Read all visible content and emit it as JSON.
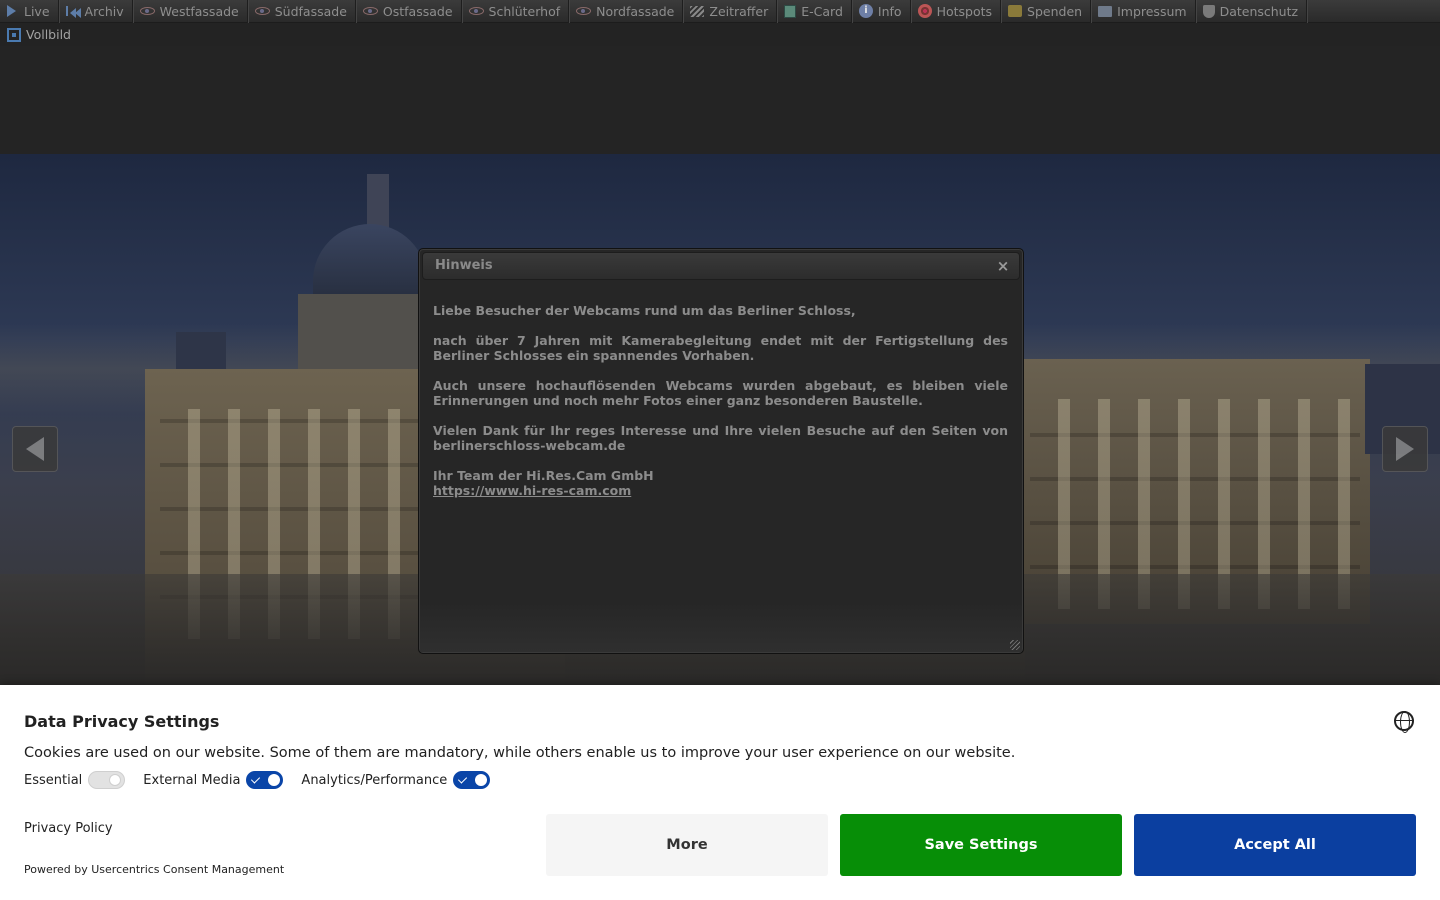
{
  "nav": {
    "row1": [
      {
        "label": "Live",
        "icon": "play-icon"
      },
      {
        "label": "Archiv",
        "icon": "rewind-icon"
      },
      {
        "label": "Westfassade",
        "icon": "eye-icon"
      },
      {
        "label": "Südfassade",
        "icon": "eye-icon"
      },
      {
        "label": "Ostfassade",
        "icon": "eye-icon"
      },
      {
        "label": "Schlüterhof",
        "icon": "eye-icon"
      },
      {
        "label": "Nordfassade",
        "icon": "eye-icon"
      },
      {
        "label": "Zeitraffer",
        "icon": "clapperboard-icon"
      },
      {
        "label": "E-Card",
        "icon": "ecard-icon"
      },
      {
        "label": "Info",
        "icon": "info-icon"
      },
      {
        "label": "Hotspots",
        "icon": "target-icon"
      },
      {
        "label": "Spenden",
        "icon": "coins-icon"
      },
      {
        "label": "Impressum",
        "icon": "imprint-icon"
      },
      {
        "label": "Datenschutz",
        "icon": "shield-icon"
      }
    ],
    "row2": [
      {
        "label": "Vollbild",
        "icon": "fullscreen-icon"
      }
    ]
  },
  "dialog": {
    "title": "Hinweis",
    "close_symbol": "×",
    "paragraphs": [
      "Liebe Besucher der Webcams rund um das Berliner Schloss,",
      "nach über 7 Jahren mit Kamerabegleitung endet mit der Fertigstellung des Berliner Schlosses ein spannendes Vorhaben.",
      "Auch unsere hochauflösenden Webcams wurden abgebaut, es bleiben viele Erinnerungen und noch mehr Fotos einer ganz besonderen Baustelle.",
      "Vielen Dank für Ihr reges Interesse und Ihre vielen Besuche auf den Seiten von berlinerschloss-webcam.de"
    ],
    "signature": "Ihr Team der Hi.Res.Cam GmbH",
    "link_text": "https://www.hi-res-cam.com"
  },
  "consent": {
    "title": "Data Privacy Settings",
    "description": "Cookies are used on our website. Some of them are mandatory, while others enable us to improve your user experience on our website.",
    "toggles": [
      {
        "label": "Essential",
        "state": "on-disabled"
      },
      {
        "label": "External Media",
        "state": "on"
      },
      {
        "label": "Analytics/Performance",
        "state": "on"
      }
    ],
    "privacy_link": "Privacy Policy",
    "powered_by": "Powered by Usercentrics Consent Management",
    "buttons": {
      "more": "More",
      "save": "Save Settings",
      "accept": "Accept All"
    },
    "colors": {
      "save": "#078e07",
      "accept": "#0b3fa0",
      "toggle_on": "#0a45a8"
    }
  }
}
